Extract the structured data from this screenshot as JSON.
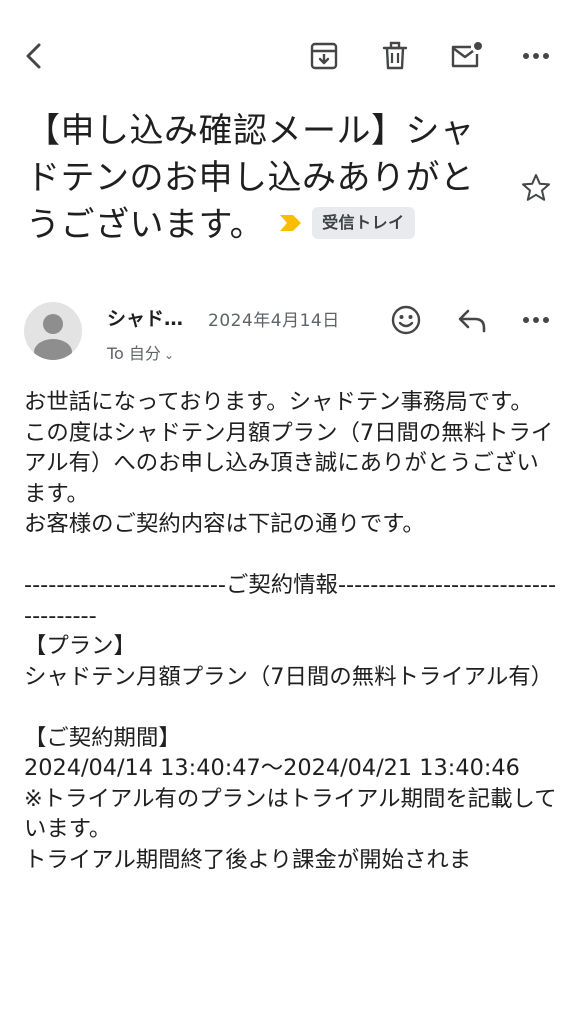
{
  "toolbar": {
    "back_icon": "back-arrow-icon",
    "archive_icon": "archive-icon",
    "delete_icon": "trash-icon",
    "mark_unread_icon": "mark-unread-icon",
    "more_icon": "more-horizontal-icon"
  },
  "email": {
    "subject": "【申し込み確認メール】シャドテンのお申し込みありがとうございます。",
    "label": "受信トレイ",
    "label_color": "#fbbc04",
    "sender": "シャド…",
    "date": "2024年4月14日",
    "recipient": "To 自分",
    "body": [
      "お世話になっております。シャドテン事務局です。",
      "この度はシャドテン月額プラン（7日間の無料トライアル有）へのお申し込み頂き誠にありがとうございます。",
      "お客様のご契約内容は下記の通りです。",
      "",
      "-------------------------ご契約情報------------------------------------",
      "【プラン】",
      "シャドテン月額プラン（7日間の無料トライアル有）",
      "",
      "【ご契約期間】",
      "2024/04/14 13:40:47～2024/04/21 13:40:46",
      "※トライアル有のプランはトライアル期間を記載しています。",
      "トライアル期間終了後より課金が開始されま"
    ]
  }
}
